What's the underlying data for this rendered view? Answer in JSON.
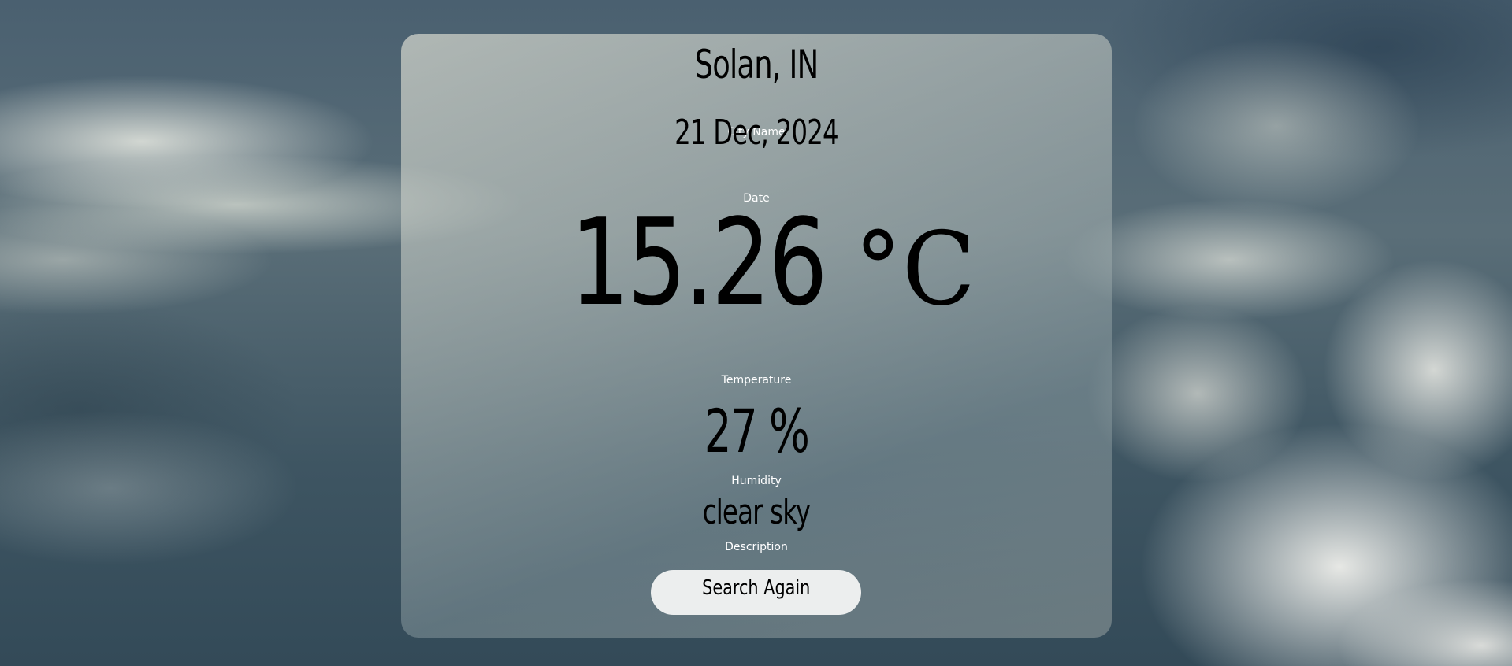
{
  "weather": {
    "city": "Solan, IN",
    "city_caption": "City Name",
    "date": "21 Dec, 2024",
    "date_caption": "Date",
    "temperature": "15.26",
    "temperature_unit": "°C",
    "temperature_caption": "Temperature",
    "humidity": "27 %",
    "humidity_caption": "Humidity",
    "description": "clear sky",
    "description_caption": "Description"
  },
  "actions": {
    "search_again_label": "Search Again"
  },
  "colors": {
    "text": "#000000",
    "caption": "#ffffff",
    "button_bg": "#eceeee"
  }
}
